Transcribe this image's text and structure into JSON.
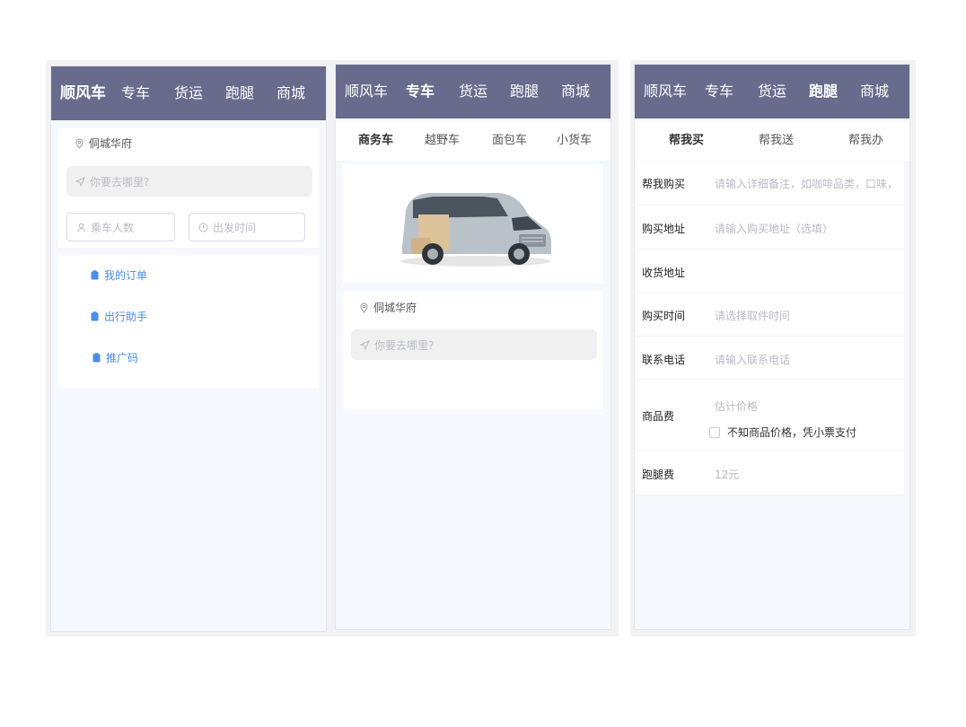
{
  "panel1": {
    "nav": [
      "顺风车",
      "专车",
      "货运",
      "跑腿",
      "商城"
    ],
    "location": "侗城华府",
    "destination_placeholder": "你要去哪里?",
    "passengers_placeholder": "乘车人数",
    "departure_placeholder": "出发时间",
    "menu": [
      "我的订单",
      "出行助手",
      "推广码"
    ],
    "accent": "#4a8ee8"
  },
  "panel2": {
    "nav": [
      "顺风车",
      "专车",
      "货运",
      "跑腿",
      "商城"
    ],
    "subtabs": [
      "商务车",
      "越野车",
      "面包车",
      "小货车"
    ],
    "location": "侗城华府",
    "destination_placeholder": "你要去哪里?",
    "image": "white-van-with-side-seat"
  },
  "panel3": {
    "nav": [
      "顺风车",
      "专车",
      "货运",
      "跑腿",
      "商城"
    ],
    "subtabs": [
      "帮我买",
      "帮我送",
      "帮我办"
    ],
    "form": {
      "item_label": "帮我购买",
      "item_placeholder": "请输入详细备注，如咖啡品类，口味，",
      "buy_addr_label": "购买地址",
      "buy_addr_placeholder": "请输入购买地址（选填）",
      "recv_addr_label": "收货地址",
      "time_label": "购买时间",
      "time_placeholder": "请选择取件时间",
      "phone_label": "联系电话",
      "phone_placeholder": "请输入联系电话",
      "goods_fee_label": "商品费",
      "goods_fee_placeholder": "估计价格",
      "unknown_price_text": "不知商品价格，凭小票支付",
      "errand_fee_label": "跑腿费",
      "errand_fee_value": "12元"
    }
  },
  "colors": {
    "nav_bg": "#686b8c",
    "page_bg": "#f5f8fd",
    "accent": "#4a8ee8"
  }
}
